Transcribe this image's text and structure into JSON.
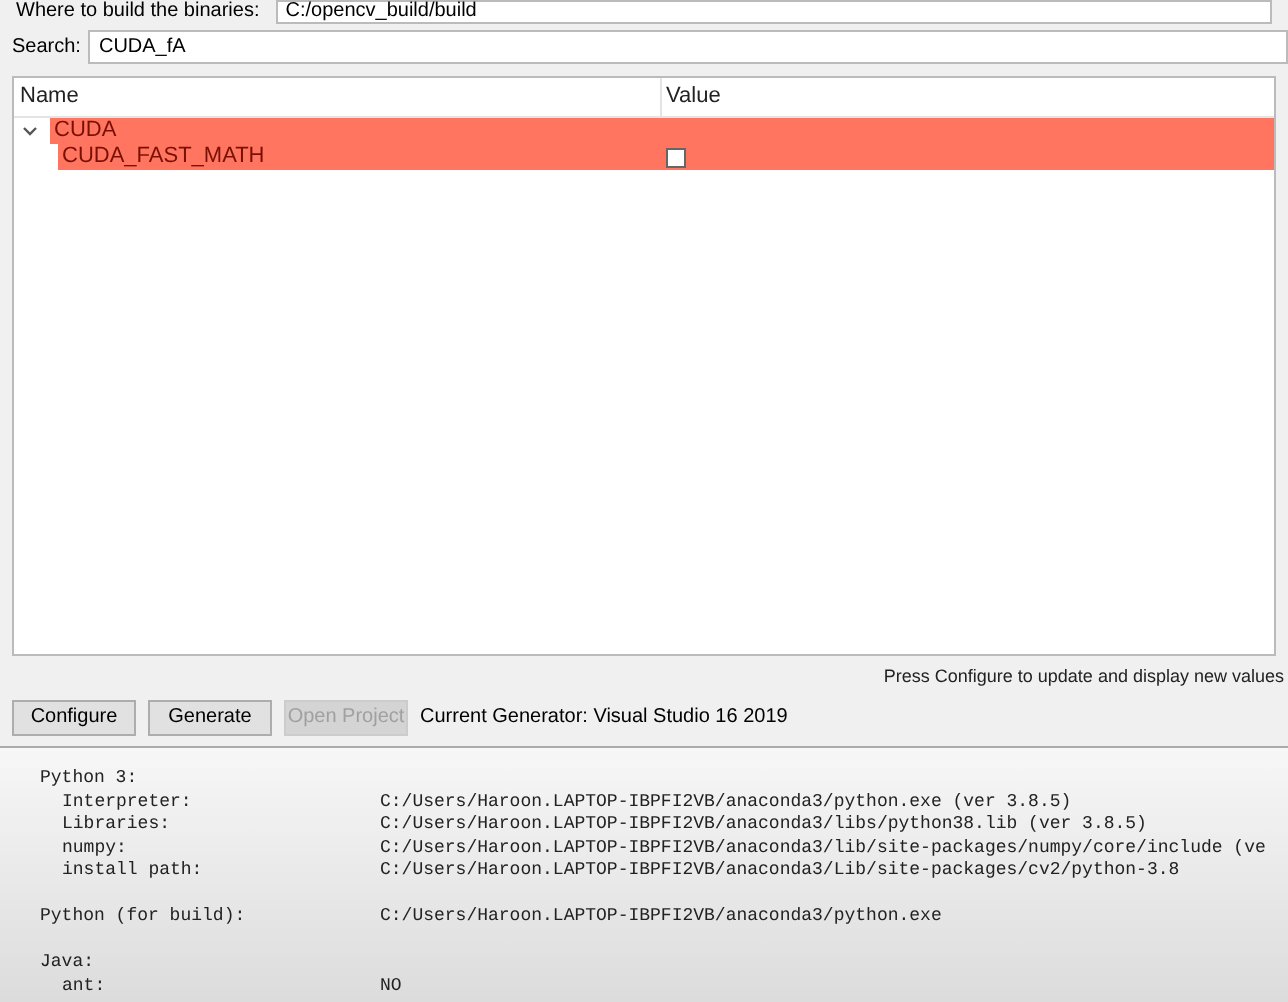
{
  "build_dir": {
    "label": "Where to build the binaries:",
    "value": "C:/opencv_build/build"
  },
  "search": {
    "label": "Search:",
    "value": "CUDA_fA"
  },
  "table": {
    "columns": [
      "Name",
      "Value"
    ],
    "rows": [
      {
        "name": "CUDA",
        "expanded": true,
        "changed": true,
        "children": [
          {
            "name": "CUDA_FAST_MATH",
            "kind": "checkbox",
            "checked": false,
            "changed": true
          }
        ]
      }
    ]
  },
  "status_text": "Press Configure to update and display new values",
  "buttons": [
    {
      "label": "Configure",
      "disabled": false
    },
    {
      "label": "Generate",
      "disabled": false
    },
    {
      "label": "Open Project",
      "disabled": true
    }
  ],
  "generator": "Current Generator: Visual Studio 16 2019",
  "output": [
    {
      "title": "Python 3:",
      "entries": [
        {
          "label": "Interpreter:",
          "value": "C:/Users/Haroon.LAPTOP-IBPFI2VB/anaconda3/python.exe (ver 3.8.5)"
        },
        {
          "label": "Libraries:",
          "value": "C:/Users/Haroon.LAPTOP-IBPFI2VB/anaconda3/libs/python38.lib (ver 3.8.5)"
        },
        {
          "label": "numpy:",
          "value": "C:/Users/Haroon.LAPTOP-IBPFI2VB/anaconda3/lib/site-packages/numpy/core/include (ve"
        },
        {
          "label": "install path:",
          "value": "C:/Users/Haroon.LAPTOP-IBPFI2VB/anaconda3/Lib/site-packages/cv2/python-3.8"
        }
      ]
    },
    {
      "title": "Python (for build):",
      "value": "C:/Users/Haroon.LAPTOP-IBPFI2VB/anaconda3/python.exe"
    },
    {
      "title": "Java:",
      "entries": [
        {
          "label": "ant:",
          "value": "NO"
        }
      ]
    }
  ]
}
